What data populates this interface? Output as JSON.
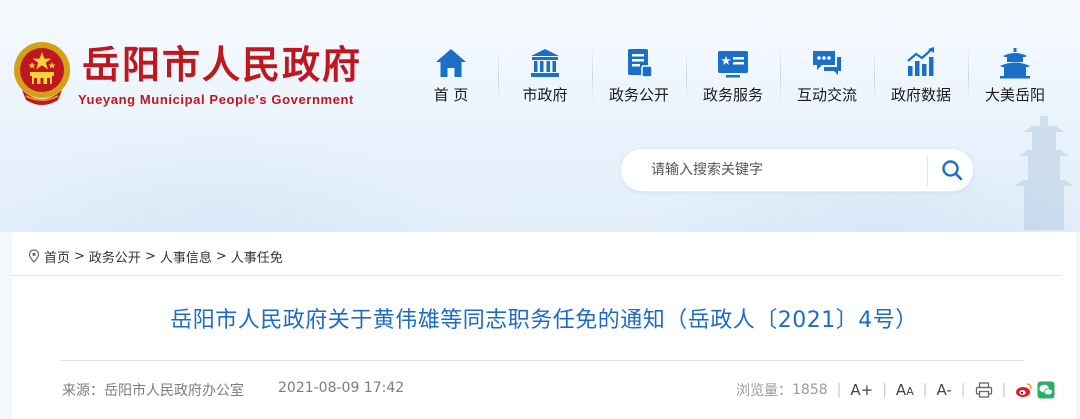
{
  "site": {
    "title": "岳阳市人民政府",
    "subtitle": "Yueyang Municipal People's Government"
  },
  "nav": [
    {
      "label": "首 页",
      "icon": "home-icon"
    },
    {
      "label": "市政府",
      "icon": "government-building-icon"
    },
    {
      "label": "政务公开",
      "icon": "document-icon"
    },
    {
      "label": "政务服务",
      "icon": "service-card-icon"
    },
    {
      "label": "互动交流",
      "icon": "chat-icon"
    },
    {
      "label": "政府数据",
      "icon": "bar-chart-icon"
    },
    {
      "label": "大美岳阳",
      "icon": "yueyang-tower-icon"
    }
  ],
  "search": {
    "placeholder": "请输入搜索关键字",
    "value": ""
  },
  "breadcrumb": [
    "首页",
    "政务公开",
    "人事信息",
    "人事任免"
  ],
  "breadcrumb_separator": ">",
  "article": {
    "title": "岳阳市人民政府关于黄伟雄等同志职务任免的通知（岳政人〔2021〕4号）",
    "source": "来源：岳阳市人民政府办公室",
    "date": "2021-08-09 17:42",
    "views_label": "浏览量：",
    "views": "1858"
  },
  "tools": {
    "font_large": "A+",
    "font_reset": "A",
    "font_reset_small": "A",
    "font_small": "A-",
    "separator": "|"
  },
  "colors": {
    "brand_red": "#c0161d",
    "nav_blue": "#1a6fc9",
    "title_blue": "#1d6bc6"
  }
}
